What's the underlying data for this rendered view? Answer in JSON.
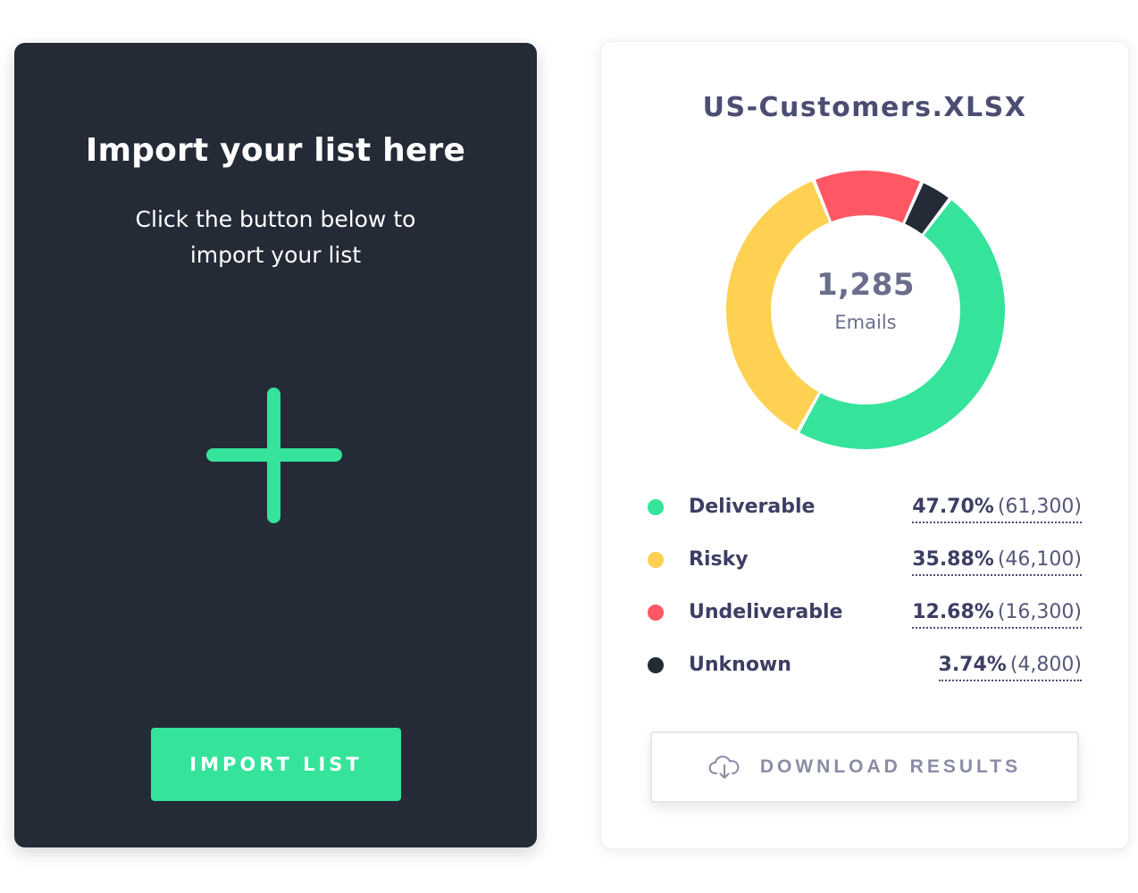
{
  "import_card": {
    "title": "Import your list here",
    "subtitle_line1": "Click the button below to",
    "subtitle_line2": "import your list",
    "button_label": "IMPORT LIST",
    "accent_color": "#35e39b",
    "background_color": "#242b37"
  },
  "results_card": {
    "file_name": "US-Customers.XLSX",
    "total": "1,285",
    "total_unit": "Emails",
    "download_label": "DOWNLOAD RESULTS",
    "legend": [
      {
        "label": "Deliverable",
        "percent": "47.70%",
        "count": "(61,300)",
        "color": "#35e39b"
      },
      {
        "label": "Risky",
        "percent": "35.88%",
        "count": "(46,100)",
        "color": "#ffd152"
      },
      {
        "label": "Undeliverable",
        "percent": "12.68%",
        "count": "(16,300)",
        "color": "#ff5864"
      },
      {
        "label": "Unknown",
        "percent": "3.74%",
        "count": "(4,800)",
        "color": "#242b37"
      }
    ]
  },
  "chart_data": {
    "type": "pie",
    "categories": [
      "Deliverable",
      "Risky",
      "Undeliverable",
      "Unknown"
    ],
    "values": [
      47.7,
      35.88,
      12.68,
      3.74
    ],
    "counts": [
      61300,
      46100,
      16300,
      4800
    ],
    "colors": [
      "#35e39b",
      "#ffd152",
      "#ff5864",
      "#242b37"
    ],
    "title": "US-Customers.XLSX",
    "center_label": "1,285",
    "center_sublabel": "Emails"
  }
}
